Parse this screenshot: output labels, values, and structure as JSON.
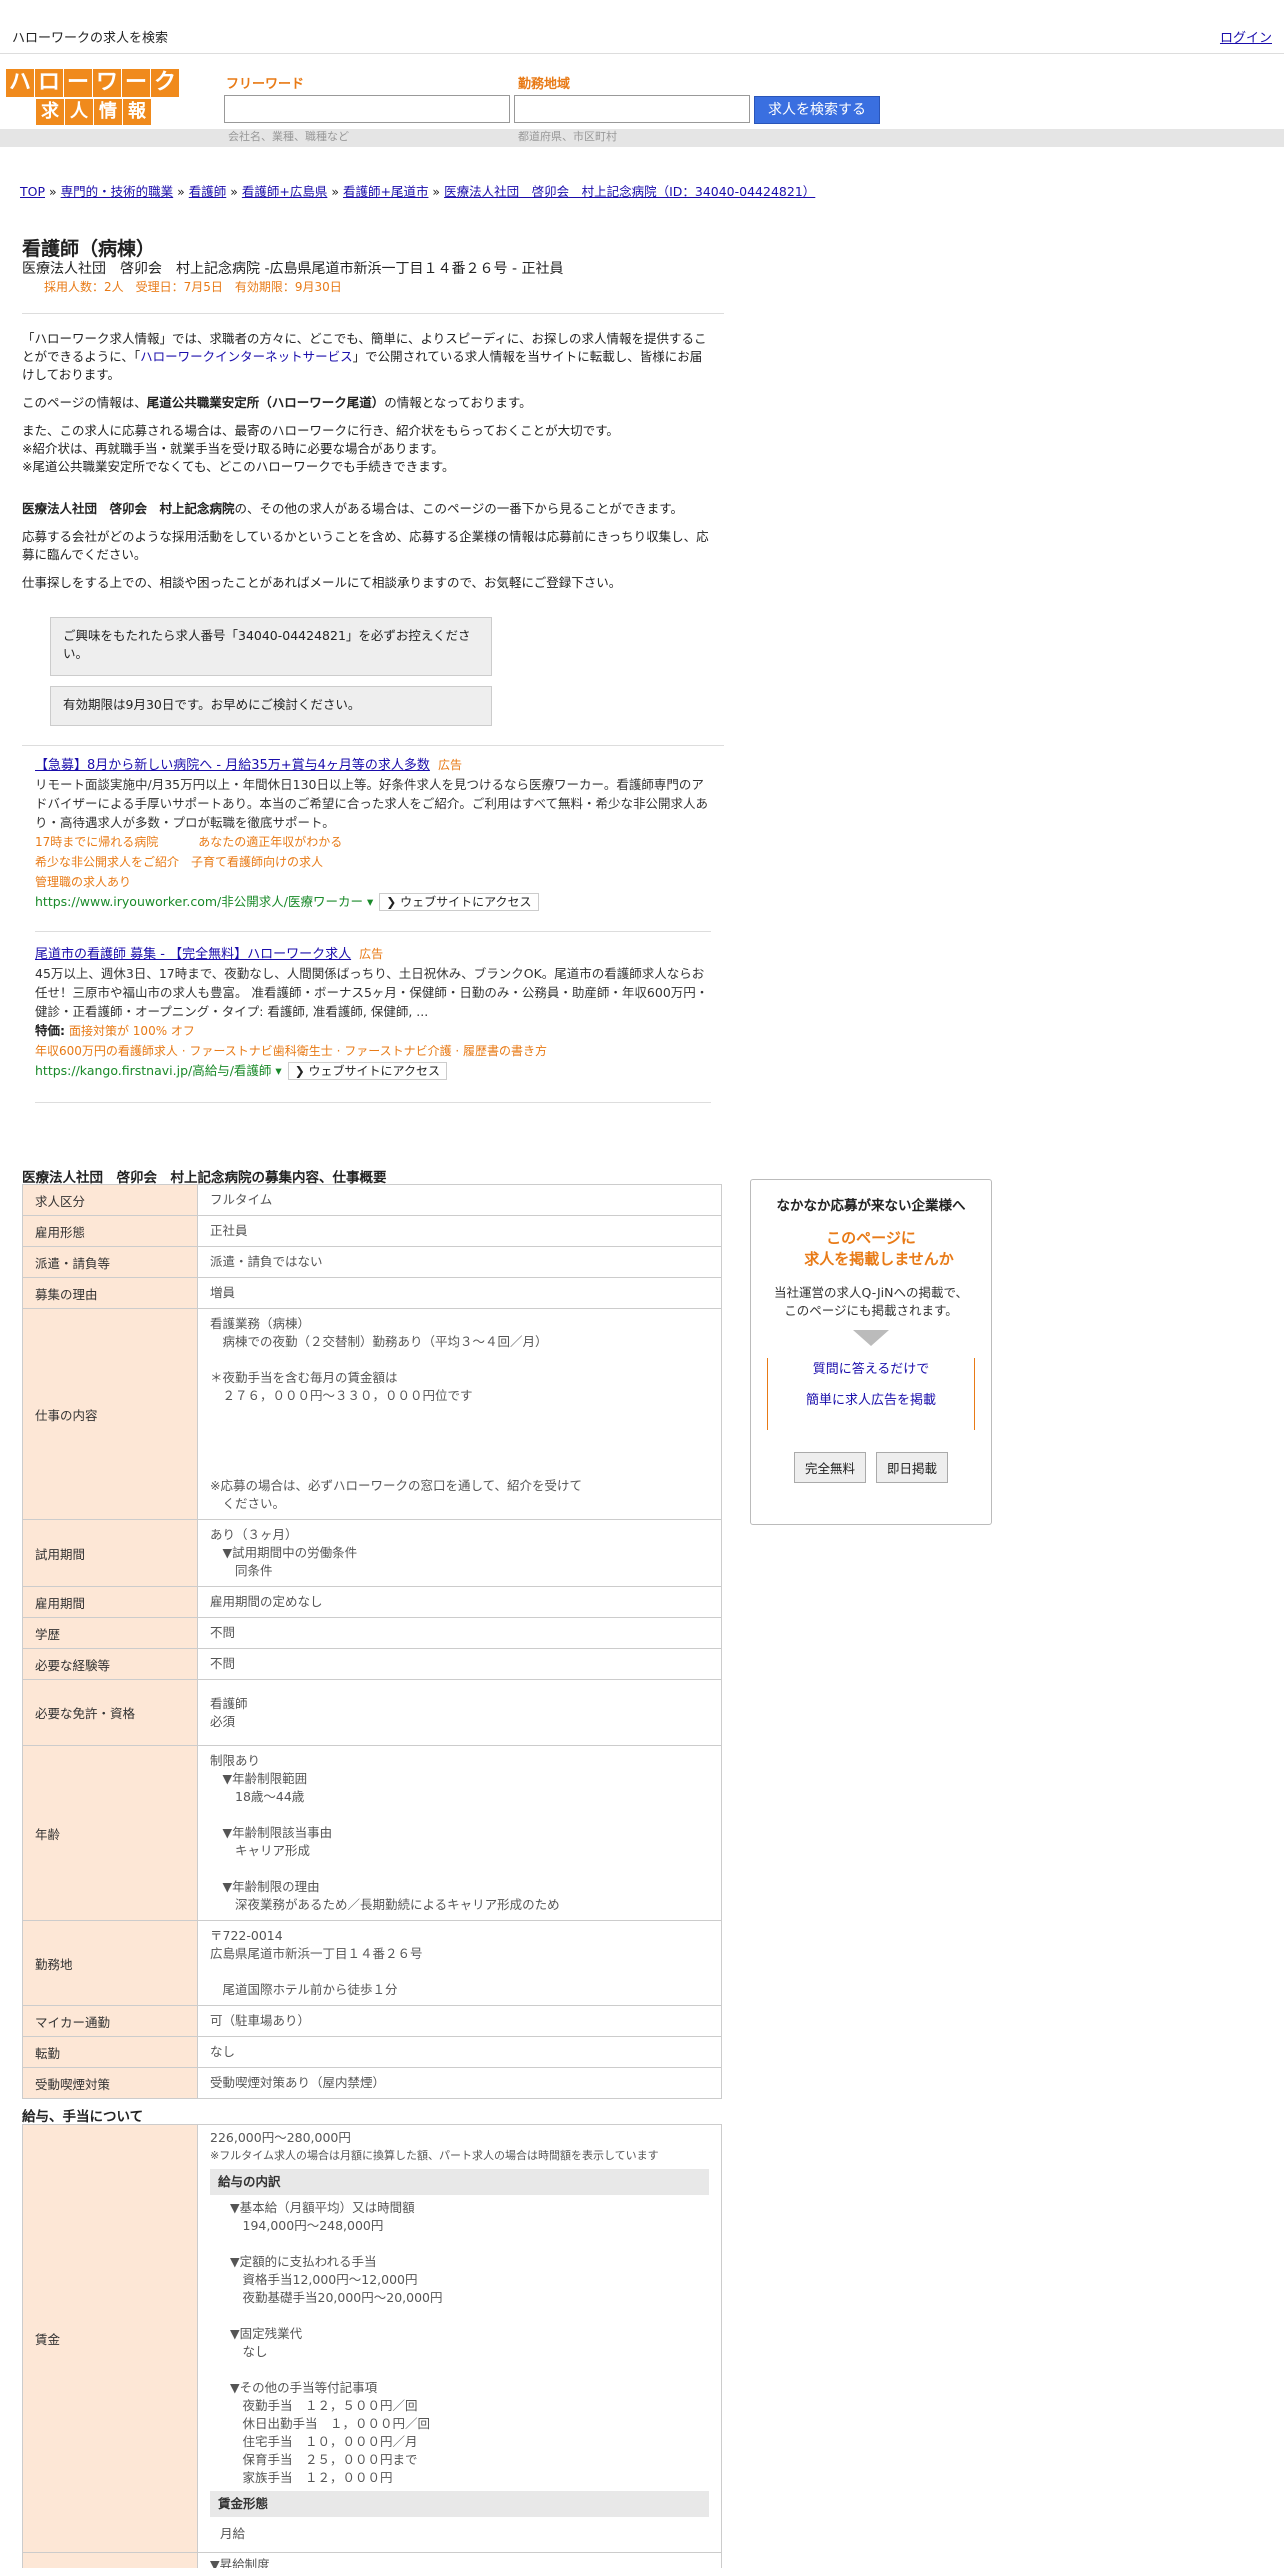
{
  "topbar": {
    "title": "ハローワークの求人を検索",
    "login": "ログイン"
  },
  "header": {
    "logo_row1": [
      "ハ",
      "ロ",
      "ー",
      "ワ",
      "ー",
      "ク"
    ],
    "logo_row2": [
      "求",
      "人",
      "情",
      "報"
    ],
    "keyword_label": "フリーワード",
    "keyword_hint": "会社名、業種、職種など",
    "area_label": "勤務地域",
    "area_hint": "都道府県、市区町村",
    "search_button": "求人を検索する"
  },
  "breadcrumb": [
    "TOP",
    "専門的・技術的職業",
    "看護師",
    "看護師+広島県",
    "看護師+尾道市",
    "医療法人社団　啓卯会　村上記念病院（ID：34040-04424821）"
  ],
  "job": {
    "title": "看護師（病棟）",
    "subtitle": "医療法人社団　啓卯会　村上記念病院 -広島県尾道市新浜一丁目１４番２６号 - 正社員",
    "meta": "採用人数：2人　受理日：7月5日　有効期限：9月30日"
  },
  "intro": {
    "p1a": "「ハローワーク求人情報」では、求職者の方々に、どこでも、簡単に、よりスピーディに、お探しの求人情報を提供することができるように、「",
    "p1link": "ハローワークインターネットサービス",
    "p1b": "」で公開されている求人情報を当サイトに転載し、皆様にお届けしております。",
    "p2a": "このページの情報は、",
    "p2b": "尾道公共職業安定所（ハローワーク尾道）",
    "p2c": "の情報となっております。",
    "p3": "また、この求人に応募される場合は、最寄のハローワークに行き、紹介状をもらっておくことが大切です。",
    "p4": "※紹介状は、再就職手当・就業手当を受け取る時に必要な場合があります。",
    "p5": "※尾道公共職業安定所でなくても、どこのハローワークでも手続きできます。",
    "p6a": "医療法人社団　啓卯会　村上記念病院",
    "p6b": "の、その他の求人がある場合は、このページの一番下から見ることができます。",
    "p7": "応募する会社がどのような採用活動をしているかということを含め、応募する企業様の情報は応募前にきっちり収集し、応募に臨んでください。",
    "p8": "仕事探しをする上での、相談や困ったことがあればメールにて相談承りますので、お気軽にご登録下さい。"
  },
  "notices": [
    "ご興味をもたれたら求人番号「34040-04424821」を必ずお控えください。",
    "有効期限は9月30日です。お早めにご検討ください。"
  ],
  "ads": [
    {
      "title": "【急募】8月から新しい病院へ - 月給35万+賞与4ヶ月等の求人多数",
      "tag": "広告",
      "desc": "リモート面談実施中/月35万円以上・年間休日130日以上等。好条件求人を見つけるなら医療ワーカー。看護師専門のアドバイザーによる手厚いサポートあり。本当のご希望に合った求人をご紹介。ご利用はすべて無料・希少な非公開求人あり・高待遇求人が多数・プロが転職を徹底サポート。",
      "links": [
        "17時までに帰れる病院",
        "あなたの適正年収がわかる",
        "希少な非公開求人をご紹介",
        "子育て看護師向けの求人",
        "管理職の求人あり"
      ],
      "url": "https://www.iryouworker.com/非公開求人/医療ワーカー",
      "visit": "❯ ウェブサイトにアクセス"
    },
    {
      "title": "尾道市の看護師 募集 - 【完全無料】ハローワーク求人",
      "tag": "広告",
      "desc": "45万以上、週休3日、17時まで、夜勤なし、人間関係ばっちり、土日祝休み、ブランクOK。尾道市の看護師求人ならお任せ！三原市や福山市の求人も豊富。 准看護師・ボーナス5ヶ月・保健師・日勤のみ・公務員・助産師・年収600万円・健診・正看護師・オープニング・タイプ: 看護師, 准看護師, 保健師, ...",
      "feature_label": "特価:",
      "feature": "面接対策が 100% オフ",
      "links2": "年収600万円の看護師求人 · ファーストナビ歯科衛生士 · ファーストナビ介護 · 履歴書の書き方",
      "url": "https://kango.firstnavi.jp/高給与/看護師",
      "visit": "❯ ウェブサイトにアクセス"
    }
  ],
  "overview": {
    "heading": "医療法人社団　啓卯会　村上記念病院の募集内容、仕事概要",
    "rows": [
      {
        "k": "求人区分",
        "v": [
          "フルタイム"
        ]
      },
      {
        "k": "雇用形態",
        "v": [
          "正社員"
        ]
      },
      {
        "k": "派遣・請負等",
        "v": [
          "派遣・請負ではない"
        ]
      },
      {
        "k": "募集の理由",
        "v": [
          "増員"
        ]
      },
      {
        "k": "仕事の内容",
        "v": [
          "看護業務（病棟）",
          "　病棟での夜勤（２交替制）勤務あり（平均３～４回／月）",
          "",
          "＊夜勤手当を含む毎月の賃金額は",
          "　２７６，０００円～３３０，０００円位です",
          "",
          "",
          "",
          "",
          "※応募の場合は、必ずハローワークの窓口を通して、紹介を受けて",
          "　ください。"
        ]
      },
      {
        "k": "試用期間",
        "v": [
          "あり（３ヶ月）",
          "　▼試用期間中の労働条件",
          "　　同条件"
        ]
      },
      {
        "k": "雇用期間",
        "v": [
          "雇用期間の定めなし"
        ]
      },
      {
        "k": "学歴",
        "v": [
          "不問"
        ]
      },
      {
        "k": "必要な経験等",
        "v": [
          "不問"
        ]
      },
      {
        "k": "必要な免許・資格",
        "v": [
          "看護師",
          "必須"
        ]
      },
      {
        "k": "年齢",
        "v": [
          "制限あり",
          "　▼年齢制限範囲",
          "　　18歳～44歳",
          "",
          "　▼年齢制限該当事由",
          "　　キャリア形成",
          "",
          "　▼年齢制限の理由",
          "　　深夜業務があるため／長期勤続によるキャリア形成のため"
        ]
      },
      {
        "k": "勤務地",
        "v": [
          "〒722-0014",
          "広島県尾道市新浜一丁目１４番２６号",
          "",
          "　尾道国際ホテル前から徒歩１分"
        ]
      },
      {
        "k": "マイカー通勤",
        "v": [
          "可（駐車場あり）"
        ]
      },
      {
        "k": "転勤",
        "v": [
          "なし"
        ]
      },
      {
        "k": "受動喫煙対策",
        "v": [
          "受動喫煙対策あり（屋内禁煙）"
        ]
      }
    ]
  },
  "salary": {
    "heading": "給与、手当について",
    "key": "賃金",
    "range": "226,000円〜280,000円",
    "note": "※フルタイム求人の場合は月額に換算した額、パート求人の場合は時間額を表示しています",
    "breakdown_title": "給与の内訳",
    "items": [
      "▼基本給（月額平均）又は時間額",
      "　194,000円〜248,000円",
      "",
      "▼定額的に支払われる手当",
      "　資格手当12,000円〜12,000円",
      "　夜勤基礎手当20,000円〜20,000円",
      "",
      "▼固定残業代",
      "　なし",
      "",
      "▼その他の手当等付記事項",
      "　夜勤手当　１２，５００円／回",
      "　休日出勤手当　１，０００円／回",
      "　住宅手当　１０，０００円／月",
      "　保育手当　２５，０００円まで",
      "　家族手当　１２，０００円"
    ],
    "form_title": "賃金形態",
    "form": "月給",
    "next": "▼昇給制度"
  },
  "side": {
    "heading": "なかなか応募が来ない企業様へ",
    "lead1": "このページに",
    "lead2": "求人を掲載しませんか",
    "p1": "当社運営の求人Q-JiNへの掲載で、",
    "p2": "このページにも掲載されます。",
    "link1": "質問に答えるだけで",
    "link2": "簡単に求人広告を掲載",
    "btn1": "完全無料",
    "btn2": "即日掲載"
  }
}
